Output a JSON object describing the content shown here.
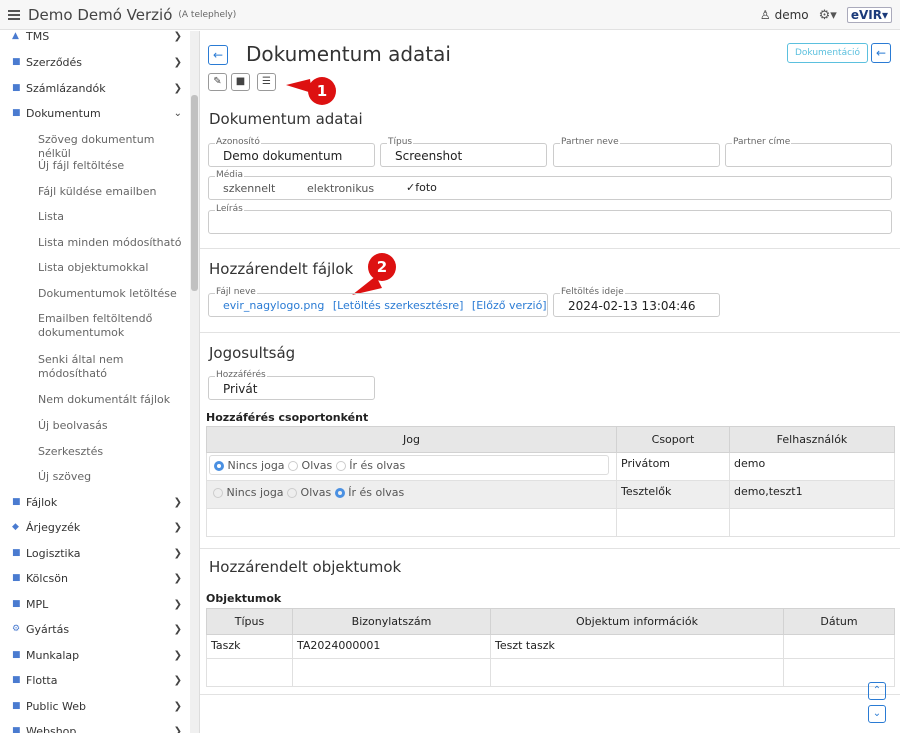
{
  "app": {
    "title": "Demo Demó Verzió",
    "site": "(A telephely)",
    "user": "demo",
    "logo": "eVIR"
  },
  "sidebar": {
    "items": [
      {
        "label": "TMS",
        "icon": "pin-icon"
      },
      {
        "label": "Szerződés",
        "icon": "contract-icon"
      },
      {
        "label": "Számlázandók",
        "icon": "billing-icon"
      },
      {
        "label": "Dokumentum",
        "icon": "document-icon"
      },
      {
        "label": "Fájlok",
        "icon": "file-icon"
      },
      {
        "label": "Árjegyzék",
        "icon": "tag-icon"
      },
      {
        "label": "Logisztika",
        "icon": "truck-icon"
      },
      {
        "label": "Kölcsön",
        "icon": "hand-icon"
      },
      {
        "label": "MPL",
        "icon": "package-icon"
      },
      {
        "label": "Gyártás",
        "icon": "gears-icon"
      },
      {
        "label": "Munkalap",
        "icon": "worksheet-icon"
      },
      {
        "label": "Flotta",
        "icon": "car-icon"
      },
      {
        "label": "Public Web",
        "icon": "web-icon"
      },
      {
        "label": "Webshop",
        "icon": "cart-icon"
      }
    ],
    "subitems": [
      "Szöveg dokumentum nélkül",
      "Új fájl feltöltése",
      "Fájl küldése emailben",
      "Lista",
      "Lista minden módosítható",
      "Lista objektumokkal",
      "Dokumentumok letöltése",
      "Emailben feltöltendő dokumentumok",
      "Senki által nem módosítható",
      "Nem dokumentált fájlok",
      "Új beolvasás",
      "Szerkesztés",
      "Új szöveg"
    ]
  },
  "header": {
    "title": "Dokumentum adatai",
    "doc_button": "Dokumentáció"
  },
  "markers": [
    "1",
    "2"
  ],
  "details": {
    "heading": "Dokumentum adatai",
    "id_label": "Azonosító",
    "id_value": "Demo dokumentum",
    "type_label": "Típus",
    "type_value": "Screenshot",
    "partner_label": "Partner neve",
    "partner_value": "",
    "address_label": "Partner címe",
    "address_value": "",
    "media_label": "Média",
    "media_options": [
      "szkennelt",
      "elektronikus",
      "foto"
    ],
    "desc_label": "Leírás",
    "desc_value": ""
  },
  "files": {
    "heading": "Hozzárendelt fájlok",
    "name_label": "Fájl neve",
    "file_name": "evir_nagylogo.png",
    "download_link": "[Letöltés szerkesztésre]",
    "prev_link": "[Előző verzió]",
    "upload_label": "Feltöltés ideje",
    "upload_value": "2024-02-13 13:04:46"
  },
  "rights": {
    "heading": "Jogosultság",
    "access_label": "Hozzáférés",
    "access_value": "Privát",
    "group_heading": "Hozzáférés csoportonként",
    "columns": [
      "Jog",
      "Csoport",
      "Felhasználók"
    ],
    "options": [
      "Nincs joga",
      "Olvas",
      "Ír és olvas"
    ],
    "rows": [
      {
        "selected": 0,
        "group": "Privátom",
        "users": "demo"
      },
      {
        "selected": 2,
        "group": "Tesztelők",
        "users": "demo,teszt1"
      }
    ]
  },
  "objects": {
    "heading": "Hozzárendelt objektumok",
    "subheading": "Objektumok",
    "columns": [
      "Típus",
      "Bizonylatszám",
      "Objektum információk",
      "Dátum"
    ],
    "rows": [
      {
        "type": "Taszk",
        "number": "TA2024000001",
        "info": "Teszt taszk",
        "date": ""
      }
    ]
  },
  "colors": {
    "accent": "#2a7bd4",
    "marker": "#d11111",
    "info": "#5bc0de"
  }
}
